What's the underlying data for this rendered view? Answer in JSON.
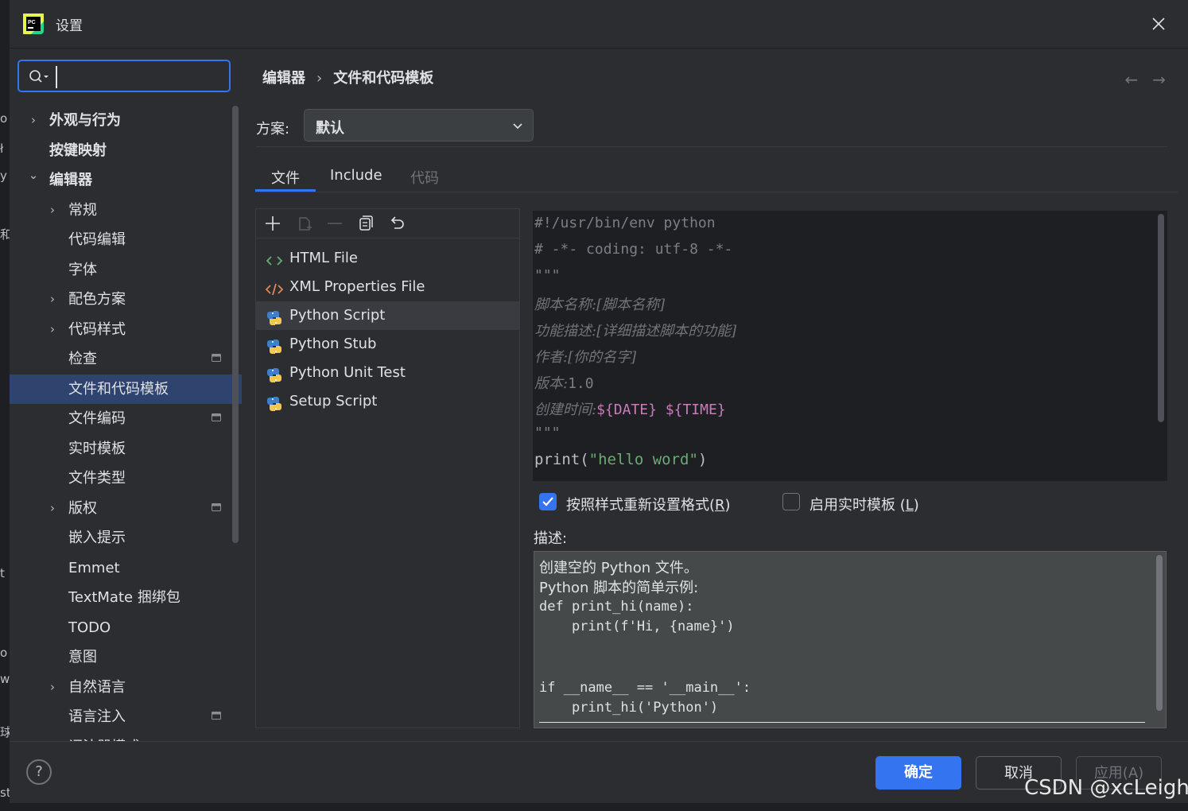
{
  "window": {
    "title": "设置"
  },
  "edge_fragments": [
    "o",
    "ł",
    "y",
    "和",
    "t",
    "o",
    "w",
    "球",
    "st"
  ],
  "search": {
    "value": "",
    "placeholder": ""
  },
  "tree": [
    {
      "label": "外观与行为",
      "level": 0,
      "expandable": true,
      "expanded": false,
      "bold": true
    },
    {
      "label": "按键映射",
      "level": 0,
      "expandable": false,
      "bold": true
    },
    {
      "label": "编辑器",
      "level": 0,
      "expandable": true,
      "expanded": true,
      "bold": true
    },
    {
      "label": "常规",
      "level": 1,
      "expandable": true,
      "expanded": false
    },
    {
      "label": "代码编辑",
      "level": 1
    },
    {
      "label": "字体",
      "level": 1
    },
    {
      "label": "配色方案",
      "level": 1,
      "expandable": true,
      "expanded": false
    },
    {
      "label": "代码样式",
      "level": 1,
      "expandable": true,
      "expanded": false
    },
    {
      "label": "检查",
      "level": 1,
      "project": true
    },
    {
      "label": "文件和代码模板",
      "level": 1,
      "selected": true
    },
    {
      "label": "文件编码",
      "level": 1,
      "project": true
    },
    {
      "label": "实时模板",
      "level": 1
    },
    {
      "label": "文件类型",
      "level": 1
    },
    {
      "label": "版权",
      "level": 1,
      "expandable": true,
      "expanded": false,
      "project": true
    },
    {
      "label": "嵌入提示",
      "level": 1
    },
    {
      "label": "Emmet",
      "level": 1
    },
    {
      "label": "TextMate 捆绑包",
      "level": 1
    },
    {
      "label": "TODO",
      "level": 1
    },
    {
      "label": "意图",
      "level": 1
    },
    {
      "label": "自然语言",
      "level": 1,
      "expandable": true,
      "expanded": false
    },
    {
      "label": "语言注入",
      "level": 1,
      "project": true
    },
    {
      "label": "词法器模式",
      "level": 1,
      "project": true
    }
  ],
  "breadcrumb": [
    "编辑器",
    "文件和代码模板"
  ],
  "nav": {
    "back": "←",
    "forward": "→"
  },
  "scheme": {
    "label": "方案:",
    "value": "默认"
  },
  "tabs": [
    {
      "label": "文件",
      "active": true
    },
    {
      "label": "Include",
      "active": false
    },
    {
      "label": "代码",
      "active": false,
      "disabled": true
    }
  ],
  "toolbar_icons": [
    "add-icon",
    "copy-icon",
    "remove-icon",
    "duplicate-icon",
    "reset-icon"
  ],
  "templates": [
    {
      "label": "HTML File",
      "icon": "html-icon"
    },
    {
      "label": "XML Properties File",
      "icon": "xml-icon"
    },
    {
      "label": "Python Script",
      "icon": "python-icon",
      "selected": true
    },
    {
      "label": "Python Stub",
      "icon": "python-icon"
    },
    {
      "label": "Python Unit Test",
      "icon": "python-icon"
    },
    {
      "label": "Setup Script",
      "icon": "python-icon"
    }
  ],
  "code": {
    "line1": "#!/usr/bin/env python",
    "line2": "# -*- coding: utf-8 -*-",
    "quote": "\"\"\"",
    "name_key": "脚本名称:",
    "name_val": "[脚本名称]",
    "func_key": "功能描述:",
    "func_val": "[详细描述脚本的功能]",
    "author_key": "作者:",
    "author_val": "[你的名字]",
    "ver_key": "版本:",
    "ver_val": "1.0",
    "time_key": "创建时间:",
    "date_var": "${DATE}",
    "time_var": "${TIME}",
    "print_fn": "print(",
    "print_str": "\"hello word\"",
    "print_end": ")"
  },
  "options": {
    "reformat": {
      "label": "按照样式重新设置格式",
      "mnemonic": "R",
      "checked": true
    },
    "live_templates": {
      "label": "启用实时模板",
      "mnemonic": "L",
      "checked": false
    }
  },
  "description": {
    "label": "描述:",
    "lines": [
      "创建空的 Python 文件。",
      "Python 脚本的简单示例:",
      "def print_hi(name):",
      "    print(f'Hi, {name}')",
      "if __name__ == '__main__':",
      "    print_hi('Python')"
    ]
  },
  "footer": {
    "help": "?",
    "ok": "确定",
    "cancel": "取消",
    "apply": "应用(A)"
  },
  "watermark": "CSDN @xcLeigh",
  "colors": {
    "accent": "#3574f0",
    "selection": "#2e436e",
    "background": "#2b2d30",
    "editor_bg": "#1e1f22"
  }
}
